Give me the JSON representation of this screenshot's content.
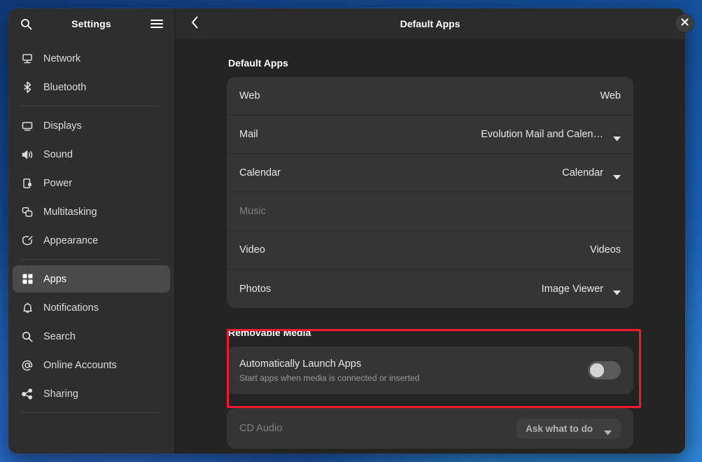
{
  "sidebar": {
    "title": "Settings",
    "search_icon": "search-icon",
    "menu_icon": "hamburger-menu-icon",
    "groups": [
      {
        "items": [
          {
            "label": "Network",
            "icon": "network-wired-icon",
            "selected": false
          },
          {
            "label": "Bluetooth",
            "icon": "bluetooth-icon",
            "selected": false
          }
        ]
      },
      {
        "items": [
          {
            "label": "Displays",
            "icon": "display-icon",
            "selected": false
          },
          {
            "label": "Sound",
            "icon": "sound-speaker-icon",
            "selected": false
          },
          {
            "label": "Power",
            "icon": "power-battery-icon",
            "selected": false
          },
          {
            "label": "Multitasking",
            "icon": "multitasking-windows-icon",
            "selected": false
          },
          {
            "label": "Appearance",
            "icon": "appearance-brush-icon",
            "selected": false
          }
        ]
      },
      {
        "items": [
          {
            "label": "Apps",
            "icon": "apps-grid-icon",
            "selected": true
          },
          {
            "label": "Notifications",
            "icon": "bell-icon",
            "selected": false
          },
          {
            "label": "Search",
            "icon": "search-icon",
            "selected": false
          },
          {
            "label": "Online Accounts",
            "icon": "at-sign-icon",
            "selected": false
          },
          {
            "label": "Sharing",
            "icon": "share-nodes-icon",
            "selected": false
          }
        ]
      }
    ]
  },
  "header": {
    "back_icon": "chevron-left-icon",
    "title": "Default Apps",
    "close_icon": "close-icon",
    "close_label": "✕"
  },
  "default_apps": {
    "section_title": "Default Apps",
    "rows": [
      {
        "label": "Web",
        "value": "Web",
        "has_dropdown": false,
        "disabled": false
      },
      {
        "label": "Mail",
        "value": "Evolution Mail and Calen…",
        "has_dropdown": true,
        "disabled": false
      },
      {
        "label": "Calendar",
        "value": "Calendar",
        "has_dropdown": true,
        "disabled": false
      },
      {
        "label": "Music",
        "value": "",
        "has_dropdown": false,
        "disabled": true
      },
      {
        "label": "Video",
        "value": "Videos",
        "has_dropdown": false,
        "disabled": false
      },
      {
        "label": "Photos",
        "value": "Image Viewer",
        "has_dropdown": true,
        "disabled": false
      }
    ]
  },
  "removable_media": {
    "section_title": "Removable Media",
    "auto_launch": {
      "title": "Automatically Launch Apps",
      "subtitle": "Start apps when media is connected or inserted",
      "toggle_state": "off"
    },
    "cd_audio": {
      "label": "CD Audio",
      "value": "Ask what to do",
      "disabled": true
    }
  },
  "annotation": {
    "color": "#f01c2e",
    "target": "removable-media-section"
  }
}
